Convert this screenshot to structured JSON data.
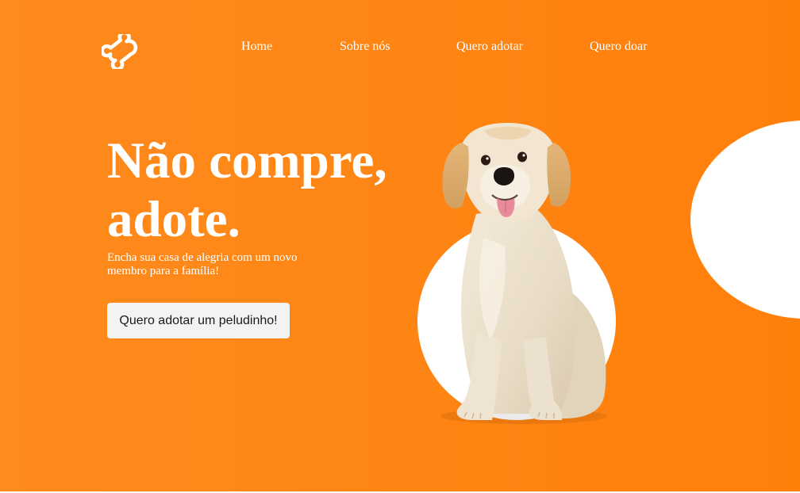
{
  "header": {
    "logo_icon": "bone-icon",
    "nav": {
      "home": "Home",
      "sobre": "Sobre nós",
      "adotar": "Quero adotar",
      "doar": "Quero doar"
    }
  },
  "hero": {
    "headline_line1": "Não compre,",
    "headline_line2": "adote.",
    "subtitle": "Encha sua casa de alegria com um novo membro para a família!",
    "cta_label": "Quero adotar um peludinho!",
    "image": "golden-retriever-dog"
  },
  "colors": {
    "background": "#ff820f",
    "accent_white": "#ffffff",
    "button_bg": "#f3f3f3"
  }
}
